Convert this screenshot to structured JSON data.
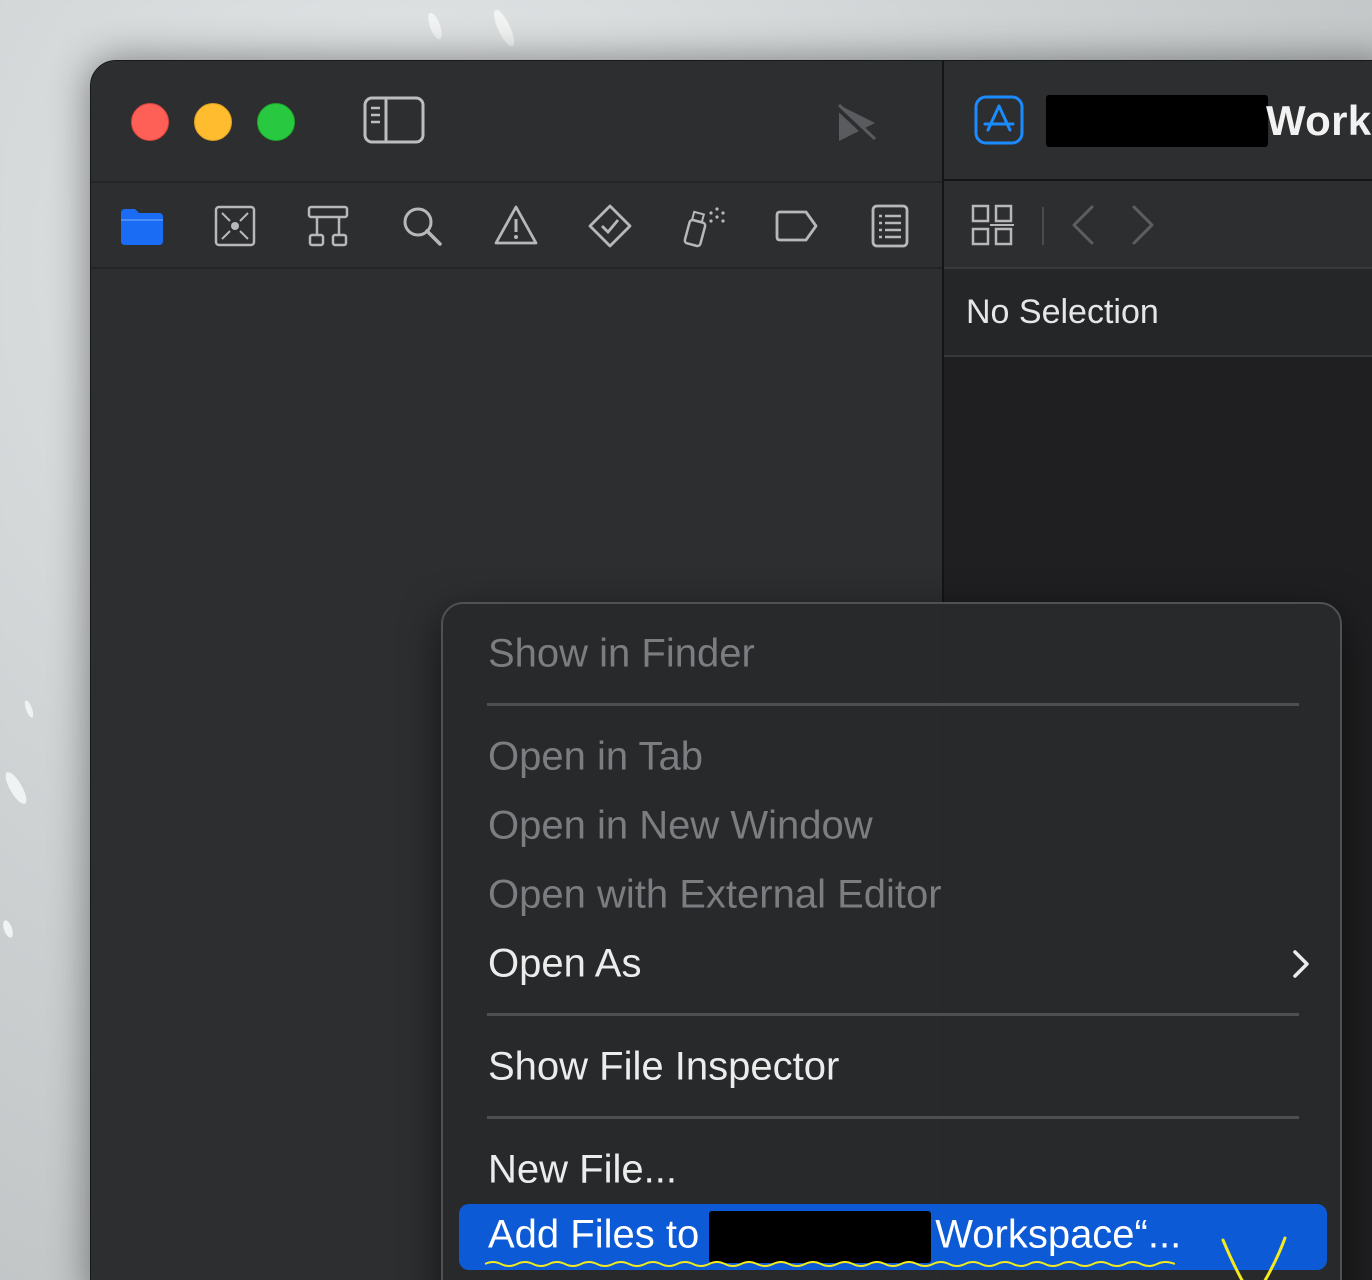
{
  "navigator": {
    "icons": [
      {
        "name": "project-navigator-folder-icon",
        "active": true
      },
      {
        "name": "source-control-navigator-icon"
      },
      {
        "name": "symbol-navigator-icon"
      },
      {
        "name": "find-navigator-search-icon"
      },
      {
        "name": "issue-navigator-warning-icon"
      },
      {
        "name": "test-navigator-icon"
      },
      {
        "name": "debug-navigator-spray-icon"
      },
      {
        "name": "breakpoint-navigator-icon"
      },
      {
        "name": "report-navigator-icon"
      }
    ]
  },
  "editor": {
    "scheme_title_suffix": "Work",
    "selection_text": "No Selection"
  },
  "context_menu": {
    "items": [
      {
        "label": "Show in Finder",
        "enabled": false
      },
      {
        "label": "Open in Tab",
        "enabled": false
      },
      {
        "label": "Open in New Window",
        "enabled": false
      },
      {
        "label": "Open with External Editor",
        "enabled": false
      },
      {
        "label": "Open As",
        "enabled": true,
        "submenu": true
      },
      {
        "label": "Show File Inspector",
        "enabled": true
      },
      {
        "label": "New File...",
        "enabled": true
      },
      {
        "label_prefix": "Add Files to",
        "label_suffix": "Workspace“...",
        "enabled": true,
        "highlighted": true
      }
    ]
  },
  "colors": {
    "accent_blue": "#0d5ad6",
    "active_icon_blue": "#1a6cf5",
    "traffic_close": "#fe5f57",
    "traffic_minimize": "#febc2e",
    "traffic_zoom": "#28c840",
    "annotation_yellow": "#f4ea1c"
  }
}
